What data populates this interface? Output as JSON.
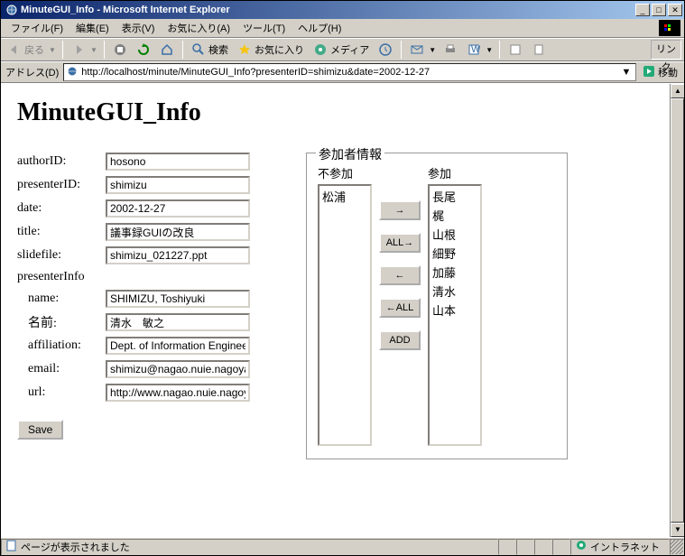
{
  "window": {
    "title": "MinuteGUI_Info - Microsoft Internet Explorer"
  },
  "menubar": {
    "items": [
      {
        "label": "ファイル(F)"
      },
      {
        "label": "編集(E)"
      },
      {
        "label": "表示(V)"
      },
      {
        "label": "お気に入り(A)"
      },
      {
        "label": "ツール(T)"
      },
      {
        "label": "ヘルプ(H)"
      }
    ]
  },
  "toolbar": {
    "back": "戻る",
    "search": "検索",
    "favorites": "お気に入り",
    "media": "メディア"
  },
  "addressbar": {
    "label": "アドレス(D)",
    "url": "http://localhost/minute/MinuteGUI_Info?presenterID=shimizu&date=2002-12-27",
    "go": "移動"
  },
  "links_label": "リンク",
  "page": {
    "heading": "MinuteGUI_Info",
    "labels": {
      "authorID": "authorID:",
      "presenterID": "presenterID:",
      "date": "date:",
      "title": "title:",
      "slidefile": "slidefile:",
      "presenterInfo": "presenterInfo",
      "name": "name:",
      "namae": "名前:",
      "affiliation": "affiliation:",
      "email": "email:",
      "url": "url:"
    },
    "values": {
      "authorID": "hosono",
      "presenterID": "shimizu",
      "date": "2002-12-27",
      "title": "議事録GUIの改良",
      "slidefile": "shimizu_021227.ppt",
      "name": "SHIMIZU, Toshiyuki",
      "namae": "清水　敏之",
      "affiliation": "Dept. of Information Engineering",
      "email": "shimizu@nagao.nuie.nagoya-u",
      "url": "http://www.nagao.nuie.nagoya"
    },
    "save_label": "Save"
  },
  "participants": {
    "legend": "参加者情報",
    "absent_header": "不参加",
    "present_header": "参加",
    "absent": [
      "松浦"
    ],
    "present": [
      "長尾",
      "梶",
      "山根",
      "細野",
      "加藤",
      "清水",
      "山本"
    ],
    "btn_right": "→",
    "btn_allright": "ALL→",
    "btn_left": "←",
    "btn_allleft": "←ALL",
    "btn_add": "ADD"
  },
  "statusbar": {
    "message": "ページが表示されました",
    "zone": "イントラネット"
  }
}
